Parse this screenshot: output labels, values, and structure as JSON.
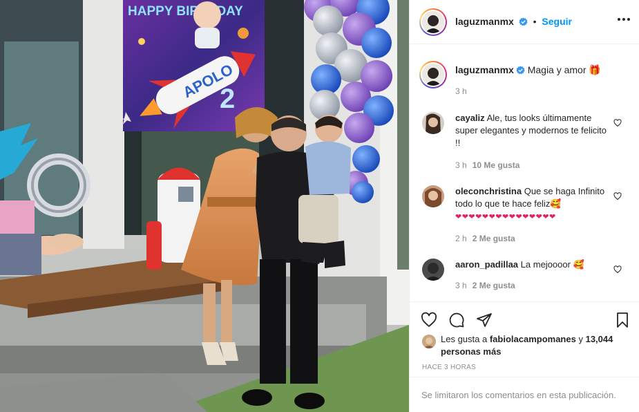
{
  "banner": {
    "top_text": "HAPPY BIRTHDAY",
    "name": "APOLO",
    "age": "2"
  },
  "header": {
    "username": "laguzmanmx",
    "separator": "•",
    "follow_label": "Seguir"
  },
  "caption": {
    "username": "laguzmanmx",
    "text": "Magia y amor",
    "emoji": "🎁",
    "time": "3 h"
  },
  "comments": [
    {
      "username": "cayaliz",
      "text": "Ale, tus looks últimamente super elegantes y modernos te felicito !!",
      "time": "3 h",
      "likes": "10 Me gusta"
    },
    {
      "username": "oleconchristina",
      "text": "Que se haga Infinito todo lo que te hace feliz🥰",
      "hearts": "❤❤❤❤❤❤❤❤❤❤❤❤❤❤❤",
      "time": "2 h",
      "likes": "2 Me gusta"
    },
    {
      "username": "aaron_padillaa",
      "text": "La mejoooor 🥰",
      "time": "3 h",
      "likes": "2 Me gusta"
    }
  ],
  "likes": {
    "prefix": "Les gusta a",
    "user": "fabiolacampomanes",
    "connector": "y",
    "count": "13,044 personas más"
  },
  "post_age": "HACE 3 HORAS",
  "comments_limited": "Se limitaron los comentarios en esta publicación.",
  "icons": {
    "like": "heart-icon",
    "comment": "comment-icon",
    "share": "share-icon",
    "save": "bookmark-icon",
    "verified": "verified-badge-icon",
    "more": "more-options-icon"
  },
  "colors": {
    "accent": "#0095f6",
    "muted": "#8e8e8e",
    "text": "#262626",
    "border": "#efefef"
  }
}
